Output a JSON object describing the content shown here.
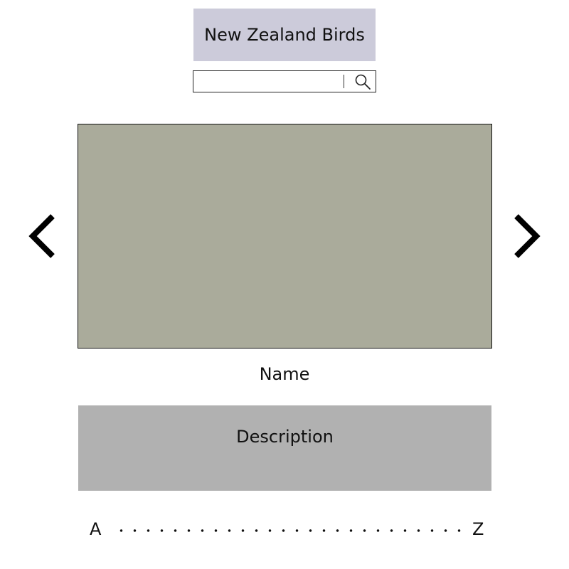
{
  "header": {
    "title": "New Zealand Birds"
  },
  "search": {
    "value": "",
    "placeholder": "",
    "icon": "search-icon"
  },
  "gallery": {
    "prev_icon": "chevron-left-icon",
    "next_icon": "chevron-right-icon",
    "image_color": "#aaab9b"
  },
  "bird": {
    "name": "Name",
    "description": "Description"
  },
  "alphabet_nav": {
    "start": "A",
    "end": "Z"
  },
  "colors": {
    "title_bg": "#cccbda",
    "description_bg": "#b1b1b1",
    "image_bg": "#aaab9b"
  }
}
